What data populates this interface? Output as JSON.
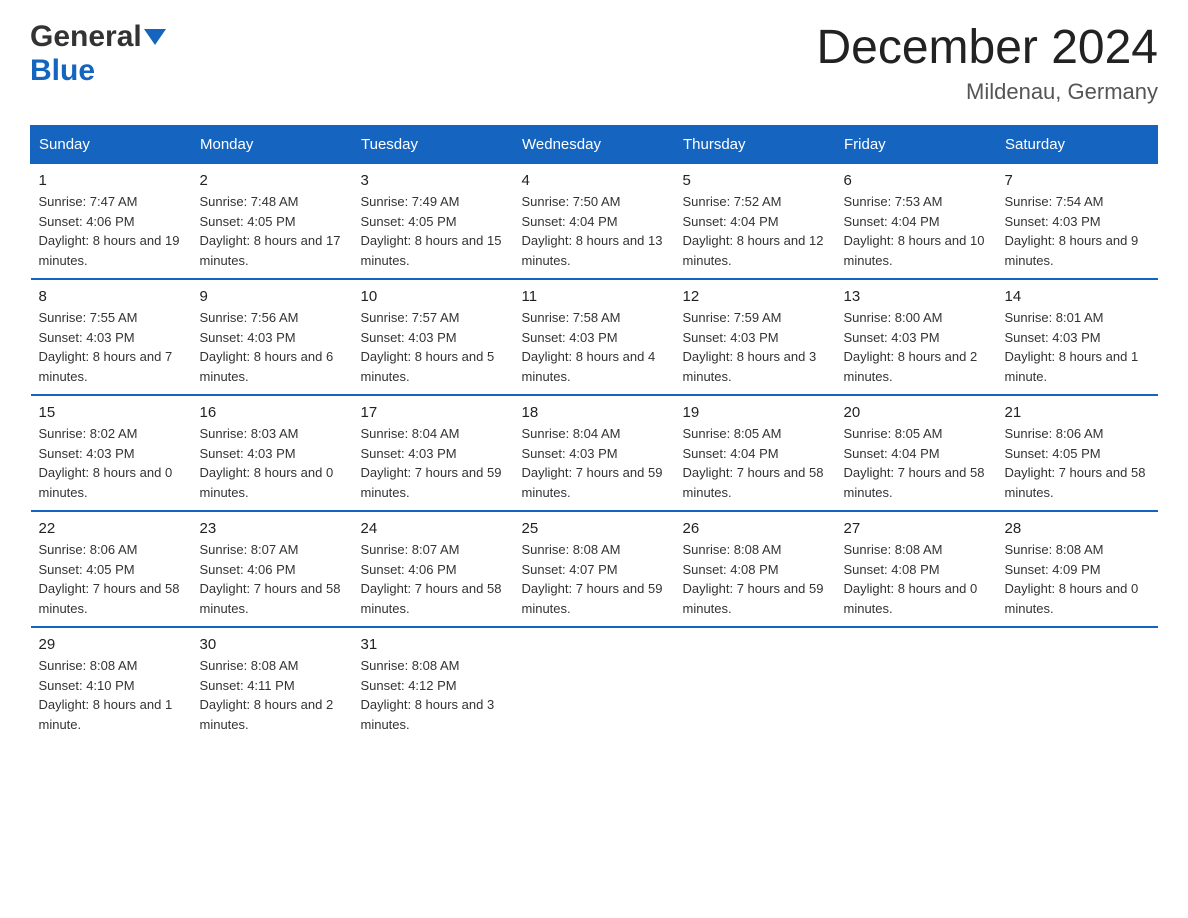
{
  "logo": {
    "general": "General",
    "arrow": "▲",
    "blue": "Blue"
  },
  "header": {
    "title": "December 2024",
    "subtitle": "Mildenau, Germany"
  },
  "weekdays": [
    "Sunday",
    "Monday",
    "Tuesday",
    "Wednesday",
    "Thursday",
    "Friday",
    "Saturday"
  ],
  "weeks": [
    [
      {
        "day": "1",
        "sunrise": "7:47 AM",
        "sunset": "4:06 PM",
        "daylight": "8 hours and 19 minutes."
      },
      {
        "day": "2",
        "sunrise": "7:48 AM",
        "sunset": "4:05 PM",
        "daylight": "8 hours and 17 minutes."
      },
      {
        "day": "3",
        "sunrise": "7:49 AM",
        "sunset": "4:05 PM",
        "daylight": "8 hours and 15 minutes."
      },
      {
        "day": "4",
        "sunrise": "7:50 AM",
        "sunset": "4:04 PM",
        "daylight": "8 hours and 13 minutes."
      },
      {
        "day": "5",
        "sunrise": "7:52 AM",
        "sunset": "4:04 PM",
        "daylight": "8 hours and 12 minutes."
      },
      {
        "day": "6",
        "sunrise": "7:53 AM",
        "sunset": "4:04 PM",
        "daylight": "8 hours and 10 minutes."
      },
      {
        "day": "7",
        "sunrise": "7:54 AM",
        "sunset": "4:03 PM",
        "daylight": "8 hours and 9 minutes."
      }
    ],
    [
      {
        "day": "8",
        "sunrise": "7:55 AM",
        "sunset": "4:03 PM",
        "daylight": "8 hours and 7 minutes."
      },
      {
        "day": "9",
        "sunrise": "7:56 AM",
        "sunset": "4:03 PM",
        "daylight": "8 hours and 6 minutes."
      },
      {
        "day": "10",
        "sunrise": "7:57 AM",
        "sunset": "4:03 PM",
        "daylight": "8 hours and 5 minutes."
      },
      {
        "day": "11",
        "sunrise": "7:58 AM",
        "sunset": "4:03 PM",
        "daylight": "8 hours and 4 minutes."
      },
      {
        "day": "12",
        "sunrise": "7:59 AM",
        "sunset": "4:03 PM",
        "daylight": "8 hours and 3 minutes."
      },
      {
        "day": "13",
        "sunrise": "8:00 AM",
        "sunset": "4:03 PM",
        "daylight": "8 hours and 2 minutes."
      },
      {
        "day": "14",
        "sunrise": "8:01 AM",
        "sunset": "4:03 PM",
        "daylight": "8 hours and 1 minute."
      }
    ],
    [
      {
        "day": "15",
        "sunrise": "8:02 AM",
        "sunset": "4:03 PM",
        "daylight": "8 hours and 0 minutes."
      },
      {
        "day": "16",
        "sunrise": "8:03 AM",
        "sunset": "4:03 PM",
        "daylight": "8 hours and 0 minutes."
      },
      {
        "day": "17",
        "sunrise": "8:04 AM",
        "sunset": "4:03 PM",
        "daylight": "7 hours and 59 minutes."
      },
      {
        "day": "18",
        "sunrise": "8:04 AM",
        "sunset": "4:03 PM",
        "daylight": "7 hours and 59 minutes."
      },
      {
        "day": "19",
        "sunrise": "8:05 AM",
        "sunset": "4:04 PM",
        "daylight": "7 hours and 58 minutes."
      },
      {
        "day": "20",
        "sunrise": "8:05 AM",
        "sunset": "4:04 PM",
        "daylight": "7 hours and 58 minutes."
      },
      {
        "day": "21",
        "sunrise": "8:06 AM",
        "sunset": "4:05 PM",
        "daylight": "7 hours and 58 minutes."
      }
    ],
    [
      {
        "day": "22",
        "sunrise": "8:06 AM",
        "sunset": "4:05 PM",
        "daylight": "7 hours and 58 minutes."
      },
      {
        "day": "23",
        "sunrise": "8:07 AM",
        "sunset": "4:06 PM",
        "daylight": "7 hours and 58 minutes."
      },
      {
        "day": "24",
        "sunrise": "8:07 AM",
        "sunset": "4:06 PM",
        "daylight": "7 hours and 58 minutes."
      },
      {
        "day": "25",
        "sunrise": "8:08 AM",
        "sunset": "4:07 PM",
        "daylight": "7 hours and 59 minutes."
      },
      {
        "day": "26",
        "sunrise": "8:08 AM",
        "sunset": "4:08 PM",
        "daylight": "7 hours and 59 minutes."
      },
      {
        "day": "27",
        "sunrise": "8:08 AM",
        "sunset": "4:08 PM",
        "daylight": "8 hours and 0 minutes."
      },
      {
        "day": "28",
        "sunrise": "8:08 AM",
        "sunset": "4:09 PM",
        "daylight": "8 hours and 0 minutes."
      }
    ],
    [
      {
        "day": "29",
        "sunrise": "8:08 AM",
        "sunset": "4:10 PM",
        "daylight": "8 hours and 1 minute."
      },
      {
        "day": "30",
        "sunrise": "8:08 AM",
        "sunset": "4:11 PM",
        "daylight": "8 hours and 2 minutes."
      },
      {
        "day": "31",
        "sunrise": "8:08 AM",
        "sunset": "4:12 PM",
        "daylight": "8 hours and 3 minutes."
      },
      null,
      null,
      null,
      null
    ]
  ],
  "labels": {
    "sunrise_prefix": "Sunrise: ",
    "sunset_prefix": "Sunset: ",
    "daylight_prefix": "Daylight: "
  }
}
